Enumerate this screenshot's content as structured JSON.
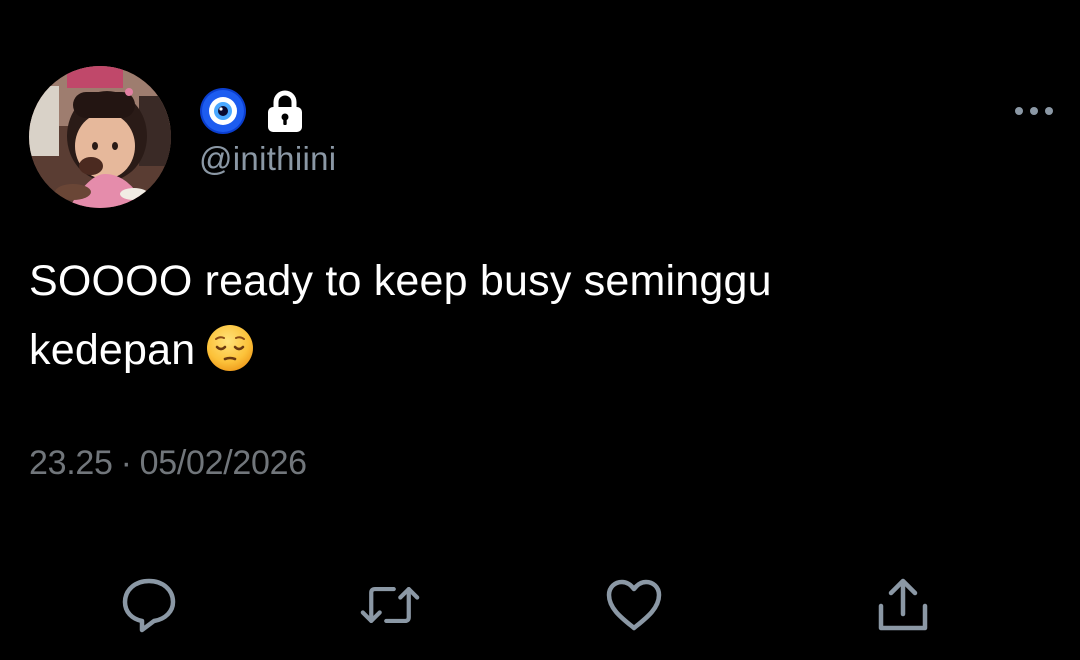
{
  "author": {
    "handle": "@inithiini",
    "name_emoji_icon": "nazar-amulet-icon",
    "protected_icon": "lock-icon",
    "avatar_icon": "avatar-photo"
  },
  "tweet": {
    "text_line_1": "SOOOO ready to keep busy seminggu",
    "text_line_2": "kedepan",
    "inline_emoji_icon": "pensive-face-icon",
    "time": "23.25",
    "separator": "·",
    "date": "05/02/2026"
  },
  "actions": [
    {
      "icon": "reply-icon"
    },
    {
      "icon": "retweet-icon"
    },
    {
      "icon": "like-icon"
    },
    {
      "icon": "share-icon"
    }
  ],
  "menu": {
    "icon": "more-options-icon"
  },
  "colors": {
    "background": "#000000",
    "text_primary": "#ffffff",
    "text_secondary": "#71767b",
    "handle": "#8b98a5",
    "icon": "#8b98a5"
  }
}
